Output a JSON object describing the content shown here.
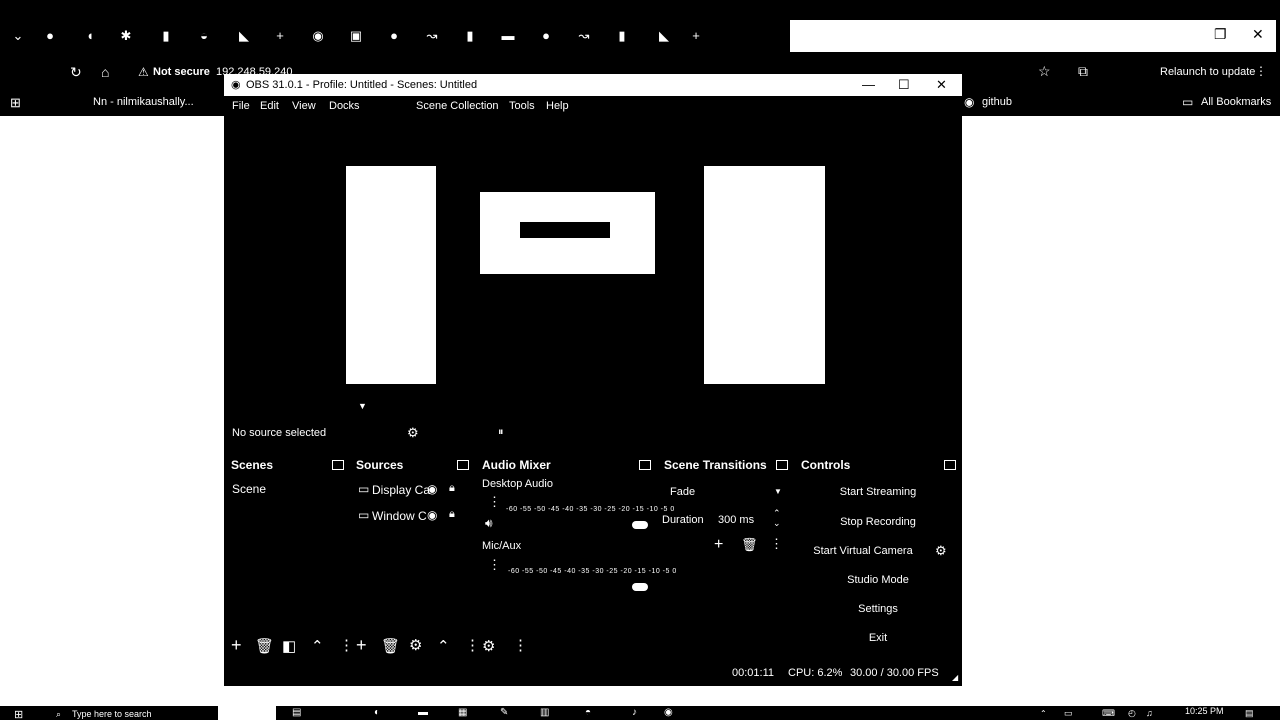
{
  "browser": {
    "address": {
      "insecure_label": "Not secure",
      "url": "192.248.59.240"
    },
    "relaunch_label": "Relaunch to update",
    "bookmarks": [
      {
        "label": "Nn - nilmikaushally..."
      },
      {
        "label": "github"
      },
      {
        "label": "All Bookmarks"
      }
    ]
  },
  "obs": {
    "title": "OBS 31.0.1 - Profile: Untitled - Scenes: Untitled",
    "menu": [
      "File",
      "Edit",
      "View",
      "Docks",
      "Scene Collection",
      "Tools",
      "Help"
    ],
    "source_status": "No source selected",
    "scenes": {
      "title": "Scenes",
      "items": [
        "Scene"
      ]
    },
    "sources": {
      "title": "Sources",
      "items": [
        "Display Ca",
        "Window C"
      ]
    },
    "mixer": {
      "title": "Audio Mixer",
      "channels": [
        {
          "name": "Desktop Audio",
          "scale": "-60 -55 -50 -45 -40 -35 -30 -25 -20 -15 -10 -5 0"
        },
        {
          "name": "Mic/Aux",
          "scale": "-60 -55 -50 -45 -40 -35 -30 -25 -20 -15 -10 -5 0"
        }
      ]
    },
    "transitions": {
      "title": "Scene Transitions",
      "type": "Fade",
      "duration_label": "Duration",
      "duration_value": "300 ms"
    },
    "controls": {
      "title": "Controls",
      "buttons": [
        "Start Streaming",
        "Stop Recording",
        "Start Virtual Camera",
        "Studio Mode",
        "Settings",
        "Exit"
      ]
    },
    "status": {
      "rec_time": "00:01:11",
      "cpu": "CPU: 6.2%",
      "fps": "30.00 / 30.00 FPS"
    }
  },
  "taskbar": {
    "search_placeholder": "Type here to search",
    "time": "10:25 PM"
  }
}
